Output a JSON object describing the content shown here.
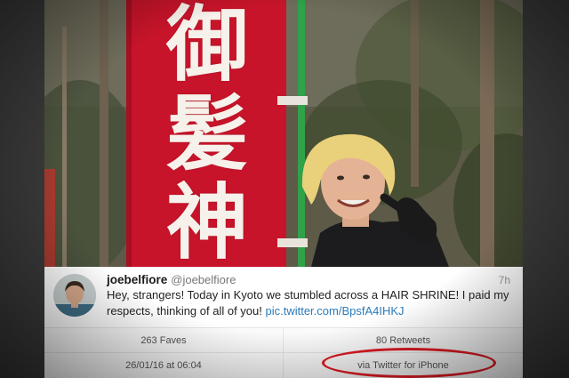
{
  "photo": {
    "banner_chars": [
      "御",
      "髪",
      "神"
    ],
    "colors": {
      "banner": "#c8142a",
      "pole": "#2fa24a"
    }
  },
  "tweet": {
    "username": "joebelfiore",
    "handle": "@joebelfiore",
    "time": "7h",
    "text": "Hey, strangers! Today in Kyoto we stumbled across a HAIR SHRINE! I paid my respects, thinking of all of you! ",
    "link": "pic.twitter.com/BpsfA4IHKJ"
  },
  "stats": {
    "faves": "263 Faves",
    "retweets": "80 Retweets",
    "date": "26/01/16 at 06:04",
    "source": "via Twitter for iPhone"
  },
  "colors": {
    "link": "#2b7bb9",
    "annotation": "#e01b24"
  }
}
